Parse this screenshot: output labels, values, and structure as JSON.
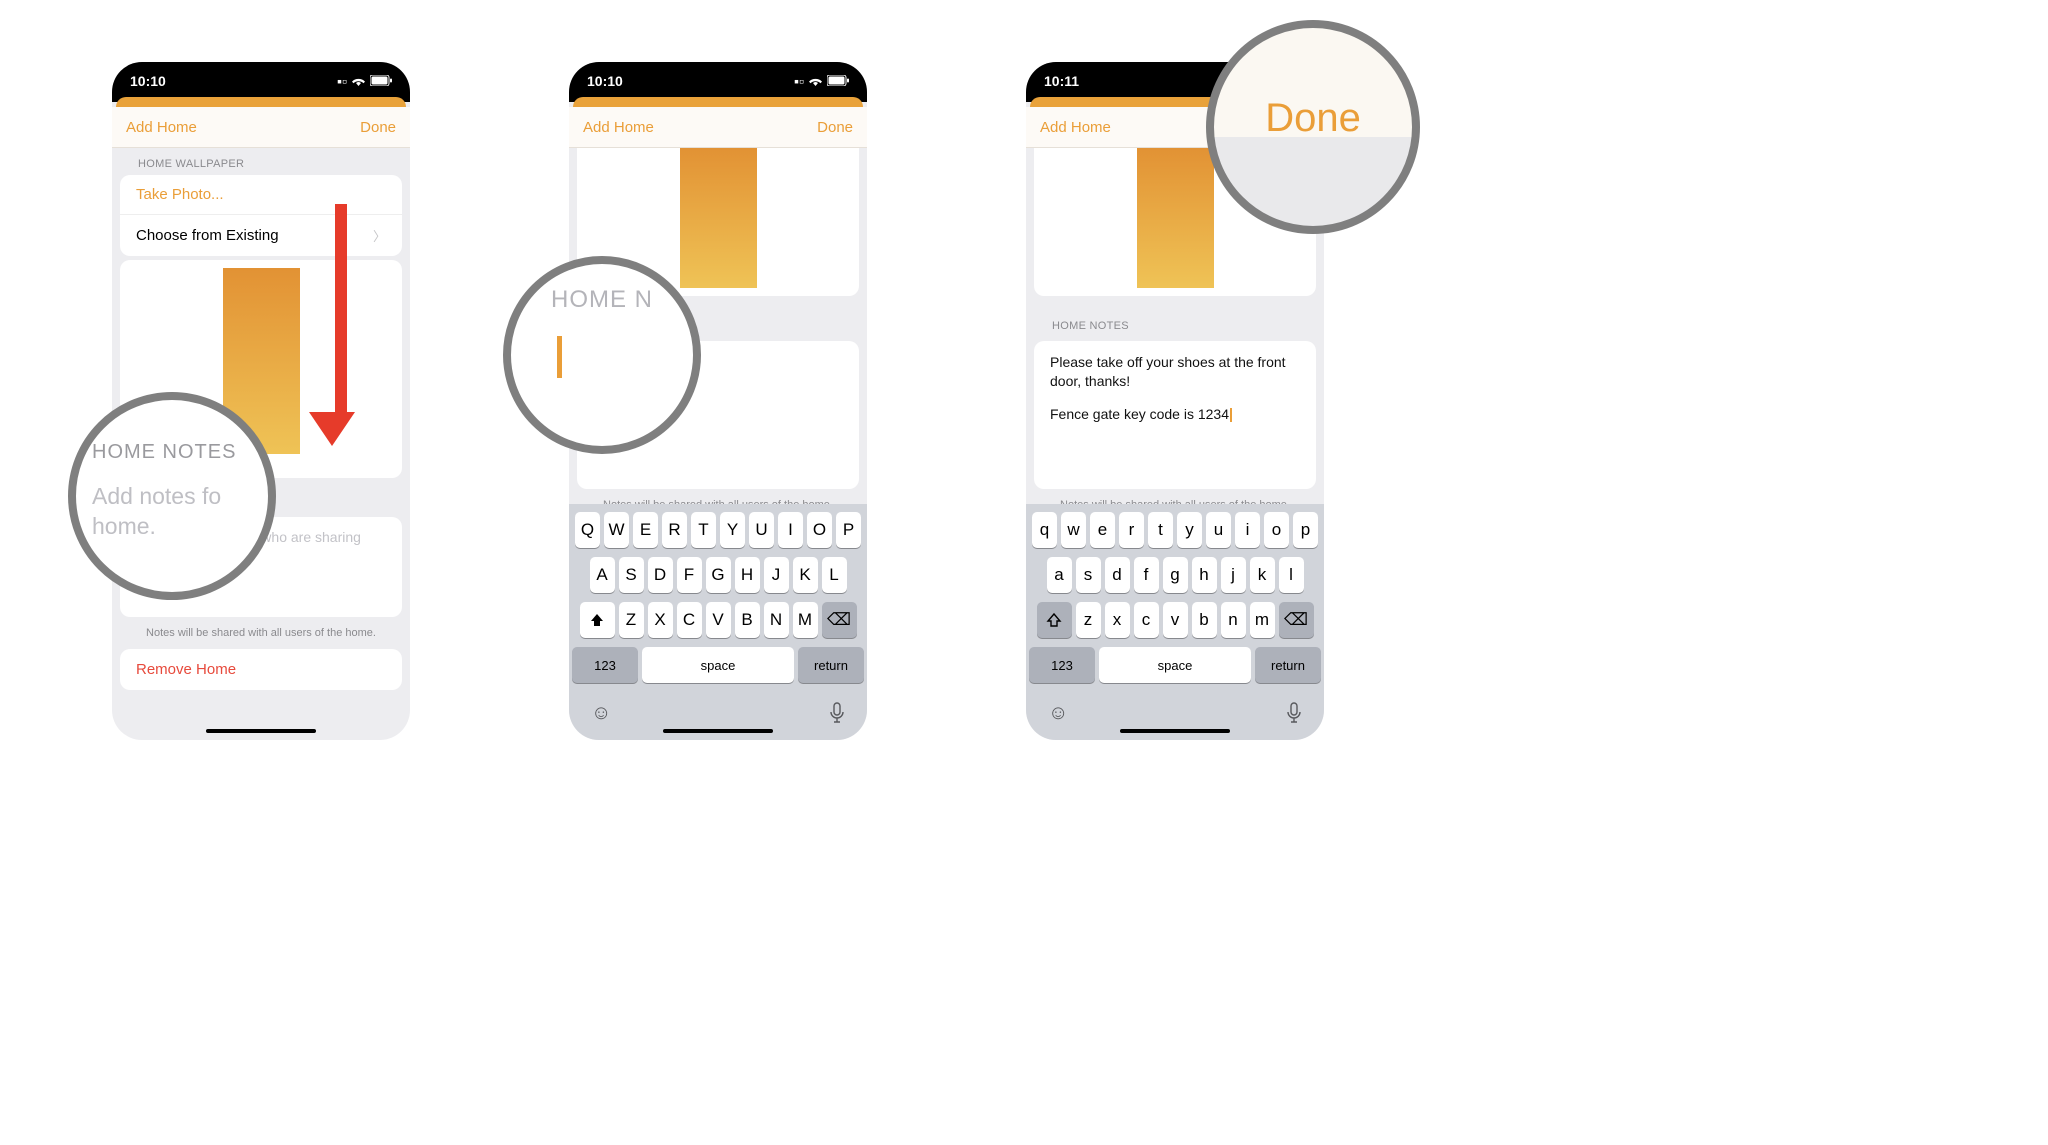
{
  "screen1": {
    "time": "10:10",
    "nav_left": "Add Home",
    "nav_right": "Done",
    "section_wallpaper": "HOME WALLPAPER",
    "take_photo": "Take Photo...",
    "choose_existing": "Choose from Existing",
    "section_notes": "HOME NOTES",
    "notes_placeholder": "Add notes for those who are sharing your home.",
    "hint": "Notes will be shared with all users of the home.",
    "remove": "Remove Home"
  },
  "screen2": {
    "time": "10:10",
    "nav_left": "Add Home",
    "nav_right": "Done",
    "section_notes": "HOME NOTES",
    "notes_value": "",
    "hint": "Notes will be shared with all users of the home."
  },
  "screen3": {
    "time": "10:11",
    "nav_left": "Add Home",
    "nav_right": "Done",
    "section_notes": "HOME NOTES",
    "notes_line1": "Please take off your shoes at the front door, thanks!",
    "notes_line2": "Fence gate key code is 1234",
    "hint": "Notes will be shared with all users of the home."
  },
  "keyboard_upper": {
    "r1": [
      "Q",
      "W",
      "E",
      "R",
      "T",
      "Y",
      "U",
      "I",
      "O",
      "P"
    ],
    "r2": [
      "A",
      "S",
      "D",
      "F",
      "G",
      "H",
      "J",
      "K",
      "L"
    ],
    "r3": [
      "Z",
      "X",
      "C",
      "V",
      "B",
      "N",
      "M"
    ],
    "mode": "123",
    "space": "space",
    "return": "return"
  },
  "keyboard_lower": {
    "r1": [
      "q",
      "w",
      "e",
      "r",
      "t",
      "y",
      "u",
      "i",
      "o",
      "p"
    ],
    "r2": [
      "a",
      "s",
      "d",
      "f",
      "g",
      "h",
      "j",
      "k",
      "l"
    ],
    "r3": [
      "z",
      "x",
      "c",
      "v",
      "b",
      "n",
      "m"
    ],
    "mode": "123",
    "space": "space",
    "return": "return"
  },
  "callouts": {
    "c1_header": "HOME NOTES",
    "c1_text": "Add notes fo\nhome.",
    "c2_header": "HOME N",
    "c3_text": "Done"
  }
}
